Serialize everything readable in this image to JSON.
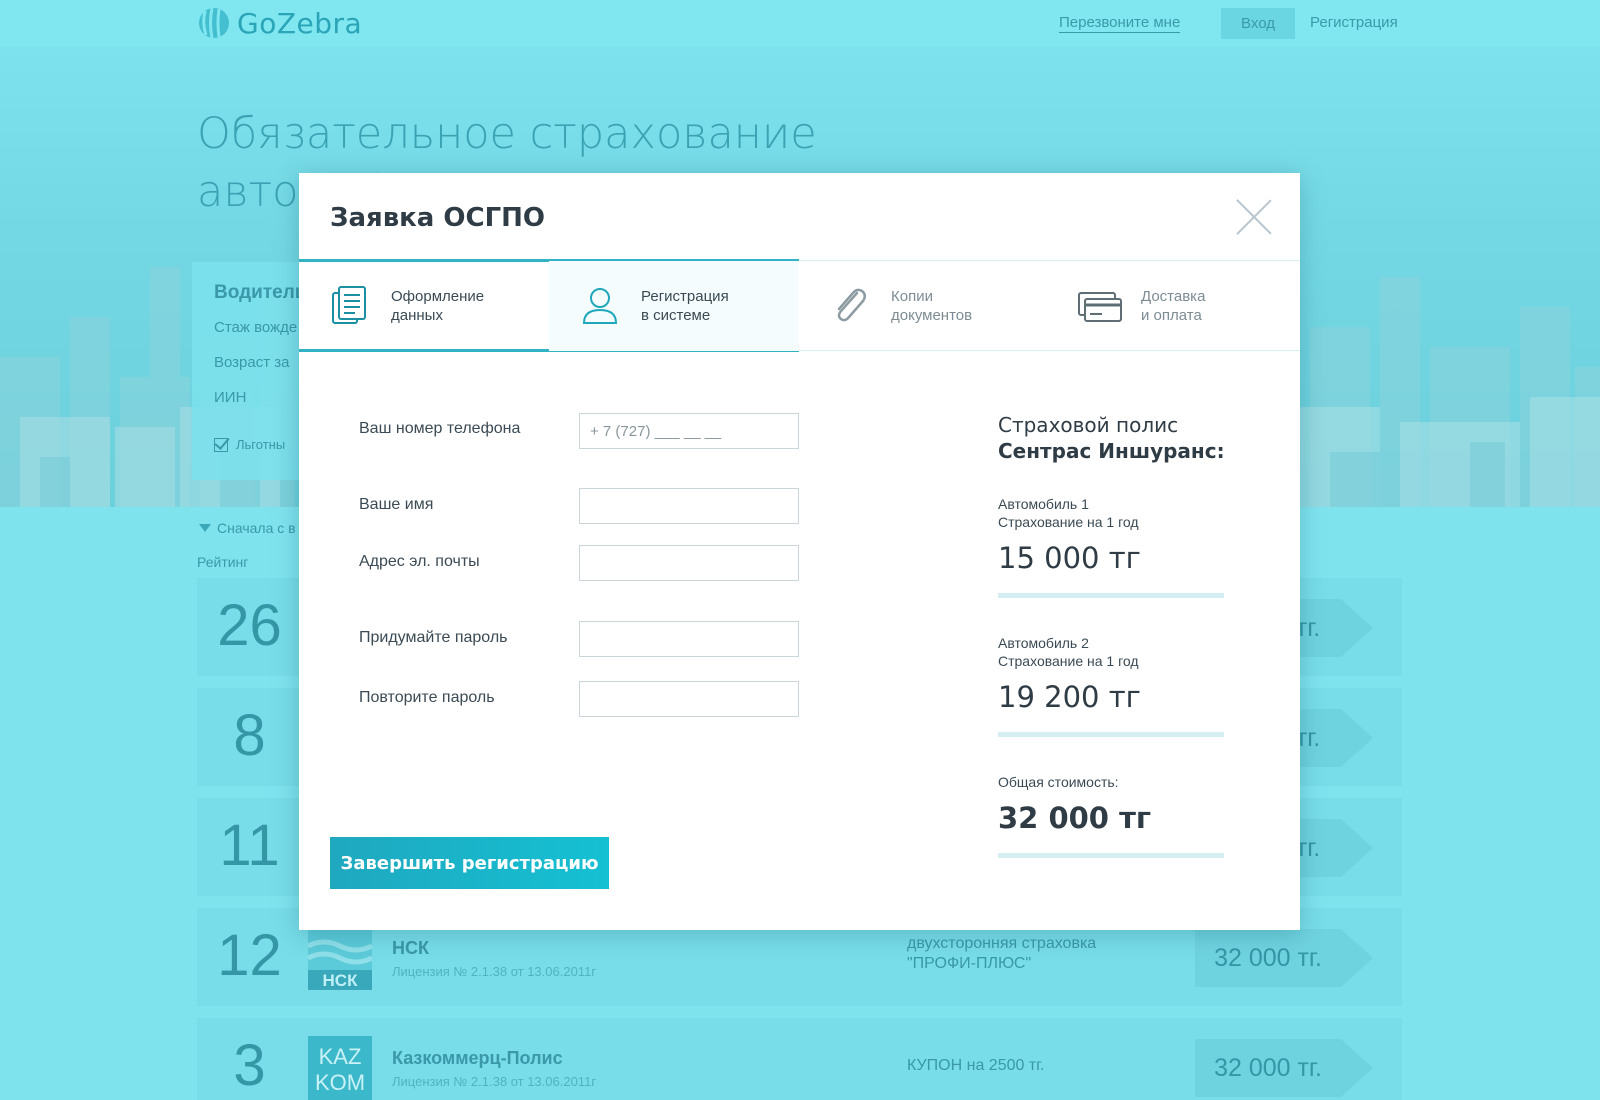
{
  "header": {
    "logo_text": "GoZebra",
    "callback_link": "Перезвоните мне",
    "login_button": "Вход",
    "register_link": "Регистрация"
  },
  "hero": {
    "title": "Обязательное страхование автомобилей"
  },
  "filter": {
    "heading": "Водитель",
    "experience_label": "Стаж вожде",
    "age_label": "Возраст за",
    "iin_label": "ИИН",
    "discount_label": "Льготны"
  },
  "list": {
    "sort_label": "Сначала с в",
    "rating_label": "Рейтинг",
    "rows": [
      {
        "rank": "26",
        "name": "",
        "license": "",
        "offer": "",
        "price": "тг."
      },
      {
        "rank": "8",
        "name": "",
        "license": "",
        "offer": "",
        "price": "тг."
      },
      {
        "rank": "11",
        "name": "",
        "license": "",
        "offer": "",
        "price": "тг."
      },
      {
        "rank": "12",
        "name": "НСК",
        "license": "Лицензия № 2.1.38 от 13.06.2011г",
        "offer": "двухсторонняя страховка \"ПРОФИ-ПЛЮС\"",
        "price": "32 000 тг."
      },
      {
        "rank": "3",
        "name": "Казкоммерц-Полис",
        "license": "Лицензия № 2.1.38 от 13.06.2011г",
        "offer": "КУПОН на 2500 тг.",
        "price": "32 000 тг."
      }
    ]
  },
  "modal": {
    "title": "Заявка ОСГПО",
    "steps": [
      {
        "label": "Оформление\nданных",
        "icon": "document-icon"
      },
      {
        "label": "Регистрация\nв системе",
        "icon": "user-icon"
      },
      {
        "label": "Копии\nдокументов",
        "icon": "paperclip-icon"
      },
      {
        "label": "Доставка\nи оплата",
        "icon": "card-icon"
      }
    ],
    "form": {
      "phone_label": "Ваш номер телефона",
      "phone_placeholder": "+ 7 (727) ___ __ __",
      "name_label": "Ваше имя",
      "email_label": "Адрес эл. почты",
      "password_label": "Придумайте пароль",
      "password_repeat_label": "Повторите пароль"
    },
    "submit_label": "Завершить регистрацию",
    "summary": {
      "heading_line1": "Страховой полис",
      "heading_line2": "Сентрас Иншуранс:",
      "car1_label": "Автомобиль 1\nСтрахование на 1 год",
      "car1_price": "15 000 тг",
      "car2_label": "Автомобиль 2\nСтрахование на 1 год",
      "car2_price": "19 200 тг",
      "total_label": "Общая стоимость:",
      "total_price": "32 000 тг"
    }
  },
  "colors": {
    "accent": "#32b3c5",
    "background": "#7fe3ee",
    "button_gradient_start": "#1fa8bf",
    "button_gradient_end": "#15c0d3"
  }
}
